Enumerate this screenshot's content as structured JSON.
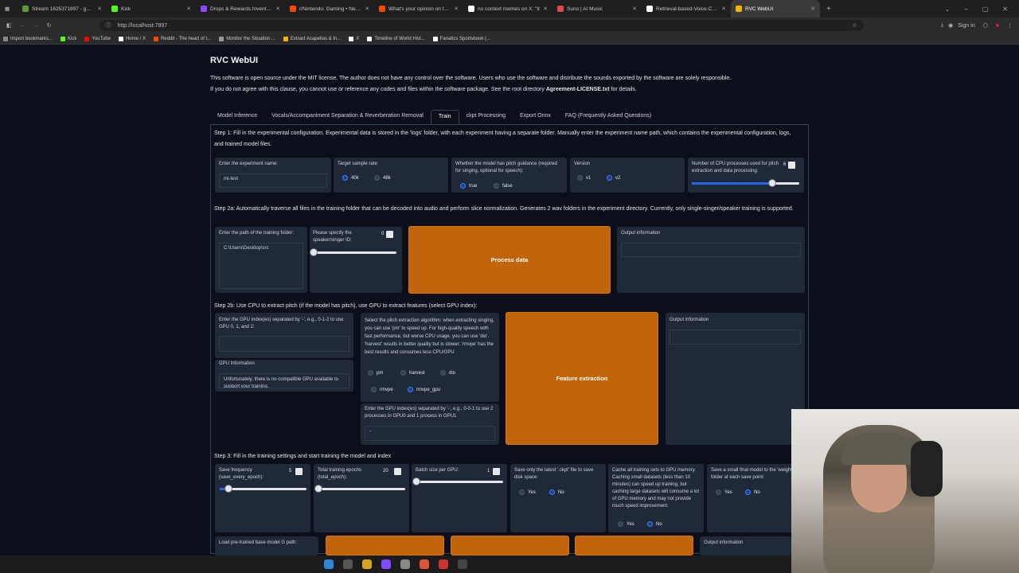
{
  "browser": {
    "tabs": [
      {
        "title": "Stream 1625371897 - garydavid",
        "color": "#5a9c3b"
      },
      {
        "title": "Kick",
        "color": "#53fc18"
      },
      {
        "title": "Drops & Rewards Inventory - K",
        "color": "#9146ff"
      },
      {
        "title": "r/Nintendo: Gaming • News • Dis",
        "color": "#ff4500"
      },
      {
        "title": "What's your opinion on the Nint",
        "color": "#ff4500"
      },
      {
        "title": "no context memes on X: \"It",
        "color": "#ffffff"
      },
      {
        "title": "Suno | AI Music",
        "color": "#e24a4a"
      },
      {
        "title": "Retrieval-based-Voice-Conversi",
        "color": "#ffffff"
      },
      {
        "title": "RVC WebUI",
        "color": "#f4b400"
      }
    ],
    "url": "http://localhost:7897",
    "signin": "Sign in",
    "bookmarks": [
      "Import bookmarks...",
      "Kick",
      "YouTube",
      "Home / X",
      "Reddit - The heart of t...",
      "Monitor the Situation ...",
      "Extract Acapellas & In...",
      "X",
      "Timeline of World Hist...",
      "Fanatics Sportsbook (..."
    ]
  },
  "page": {
    "title": "RVC WebUI",
    "notice1": "This software is open source under the MIT license. The author does not have any control over the software. Users who use the software and distribute the sounds exported by the software are solely responsible.",
    "notice2a": "If you do not agree with this clause, you cannot use or reference any codes and files within the software package. See the root directory ",
    "notice2b": "Agreement-LICENSE.txt",
    "notice2c": " for details.",
    "tabs": [
      "Model Inference",
      "Vocals/Accompaniment Separation & Reverberation Removal",
      "Train",
      "ckpt Processing",
      "Export Onnx",
      "FAQ (Frequently Asked Questions)"
    ]
  },
  "step1": {
    "text": "Step 1: Fill in the experimental configuration. Experimental data is stored in the 'logs' folder, with each experiment having a separate folder. Manually enter the experiment name path, which contains the experimental configuration, logs, and trained model files.",
    "exp_name_label": "Enter the experiment name:",
    "exp_name_value": "mi-test",
    "sr_label": "Target sample rate:",
    "sr_options": [
      "40k",
      "48k"
    ],
    "pitch_label": "Whether the model has pitch guidance (required for singing, optional for speech):",
    "pitch_options": [
      "true",
      "false"
    ],
    "version_label": "Version",
    "version_options": [
      "v1",
      "v2"
    ],
    "cpu_label": "Number of CPU processes used for pitch extraction and data processing:",
    "cpu_value": "6",
    "cpu_fraction": 0.75
  },
  "step2a": {
    "text": "Step 2a: Automatically traverse all files in the training folder that can be decoded into audio and perform slice normalization. Generates 2 wav folders in the experiment directory. Currently, only single-singer/speaker training is supported.",
    "folder_label": "Enter the path of the training folder:",
    "folder_value": "C:\\Users\\Desktop\\src",
    "speaker_label": "Please specify the speaker/singer ID:",
    "speaker_value": "0",
    "speaker_fraction": 0.0,
    "process_button": "Process data",
    "output_label": "Output information"
  },
  "step2b": {
    "text": "Step 2b: Use CPU to extract pitch (if the model has pitch), use GPU to extract features (select GPU index):",
    "gpu_label": "Enter the GPU index(es) separated by '-', e.g., 0-1-2 to use GPU 0, 1, and 2:",
    "gpu_info_label": "GPU Information",
    "gpu_info_value": "Unfortunately, there is no compatible GPU available to support your training.",
    "algo_label": "Select the pitch extraction algorithm: when extracting singing, you can use 'pm' to speed up. For high-quality speech with fast performance, but worse CPU usage, you can use 'dio'. 'harvest' results in better quality but is slower. 'rmvpe' has the best results and consumes less CPU/GPU",
    "algo_options": [
      "pm",
      "harvest",
      "dio",
      "rmvpe",
      "rmvpe_gpu"
    ],
    "gpu2_label": "Enter the GPU index(es) separated by '-', e.g., 0-0-1 to use 2 processes in GPU0 and 1 process in GPU1",
    "gpu2_value": "-",
    "feature_button": "Feature extraction",
    "output_label": "Output information"
  },
  "step3": {
    "text": "Step 3: Fill in the training settings and start training the model and index",
    "save_freq_label": "Save frequency (save_every_epoch):",
    "save_freq_value": "5",
    "save_freq_fraction": 0.1,
    "epochs_label": "Total training epochs (total_epoch):",
    "epochs_value": "20",
    "epochs_fraction": 0.0,
    "batch_label": "Batch size per GPU:",
    "batch_value": "1",
    "batch_fraction": 0.0,
    "latest_label": "Save only the latest '.ckpt' file to save disk space:",
    "latest_options": [
      "Yes",
      "No"
    ],
    "cache_label": "Cache all training sets to GPU memory. Caching small datasets (less than 10 minutes) can speed up training, but caching large datasets will consume a lot of GPU memory and may not provide much speed improvement:",
    "cache_options": [
      "Yes",
      "No"
    ],
    "final_label": "Save a small final model to the 'weights' folder at each save point:",
    "final_options": [
      "Yes",
      "No"
    ],
    "pretrained_label": "Load pre-trained base model G path:",
    "output_label": "Output information"
  }
}
